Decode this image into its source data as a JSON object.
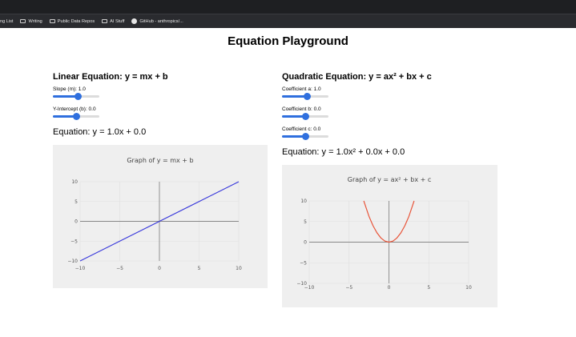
{
  "bookmarks": [
    {
      "label": "ng List",
      "icon": "none"
    },
    {
      "label": "Writing",
      "icon": "folder-icon"
    },
    {
      "label": "Public Data Repos",
      "icon": "folder-icon"
    },
    {
      "label": "AI Stuff",
      "icon": "folder-icon"
    },
    {
      "label": "GitHub - anthropics/...",
      "icon": "github-icon"
    }
  ],
  "page_title": "Equation Playground",
  "linear": {
    "title": "Linear Equation: y = mx + b",
    "slope": {
      "label": "Slope (m): 1.0",
      "value": 1.0,
      "min": -5,
      "max": 5,
      "fraction": 0.55
    },
    "intercept": {
      "label": "Y-Intercept (b): 0.0",
      "value": 0.0,
      "min": -10,
      "max": 10,
      "fraction": 0.5
    },
    "equation": "Equation: y = 1.0x + 0.0"
  },
  "quadratic": {
    "title": "Quadratic Equation: y = ax² + bx + c",
    "a": {
      "label": "Coefficient a: 1.0",
      "value": 1.0,
      "fraction": 0.55
    },
    "b": {
      "label": "Coefficient b: 0.0",
      "value": 0.0,
      "fraction": 0.5
    },
    "c": {
      "label": "Coefficient c: 0.0",
      "value": 0.0,
      "fraction": 0.5
    },
    "equation": "Equation: y = 1.0x² + 0.0x + 0.0"
  },
  "colors": {
    "slider_accent": "#2f6fde",
    "linear_line": "#3b3bdb",
    "quadratic_line": "#e8553a",
    "plot_bg": "#efefef"
  },
  "chart_data": [
    {
      "type": "line",
      "title": "Graph of y = mx + b",
      "xlim": [
        -10,
        10
      ],
      "ylim": [
        -10,
        10
      ],
      "xticks": [
        -10,
        -5,
        0,
        5,
        10
      ],
      "yticks": [
        -10,
        -5,
        0,
        5,
        10
      ],
      "xtick_labels": [
        "−10",
        "−5",
        "0",
        "5",
        "10"
      ],
      "ytick_labels": [
        "−10",
        "−5",
        "0",
        "5",
        "10"
      ],
      "series": [
        {
          "x": [
            -10,
            10
          ],
          "y": [
            -10,
            10
          ],
          "color": "#3b3bdb"
        }
      ],
      "grid": true
    },
    {
      "type": "line",
      "title": "Graph of y = ax² + bx + c",
      "xlim": [
        -10,
        10
      ],
      "ylim": [
        -10,
        10
      ],
      "xticks": [
        -10,
        -5,
        0,
        5,
        10
      ],
      "yticks": [
        -10,
        -5,
        0,
        5,
        10
      ],
      "xtick_labels": [
        "−10",
        "−5",
        "0",
        "5",
        "10"
      ],
      "ytick_labels": [
        "−10",
        "−5",
        "0",
        "5",
        "10"
      ],
      "series": [
        {
          "x": [
            -3.16,
            -2.5,
            -2,
            -1.5,
            -1,
            -0.5,
            0,
            0.5,
            1,
            1.5,
            2,
            2.5,
            3.16
          ],
          "y": [
            10,
            6.25,
            4,
            2.25,
            1,
            0.25,
            0,
            0.25,
            1,
            2.25,
            4,
            6.25,
            10
          ],
          "color": "#e8553a"
        }
      ],
      "grid": true
    }
  ]
}
